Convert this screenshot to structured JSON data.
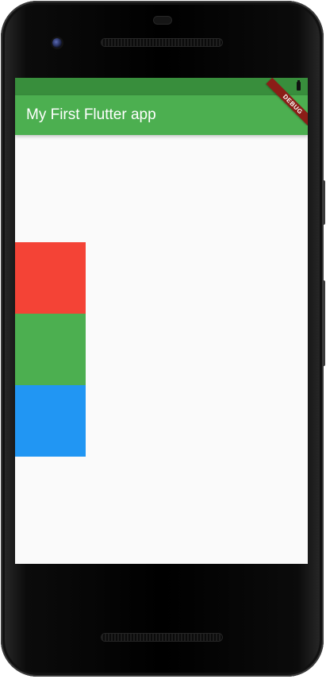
{
  "app": {
    "title": "My First Flutter app",
    "debug_banner": "DEBUG"
  },
  "theme": {
    "status_bar_color": "#388e3c",
    "app_bar_color": "#4caf50",
    "background_color": "#fafafa"
  },
  "column_boxes": [
    {
      "name": "red-box",
      "color": "#f44336"
    },
    {
      "name": "green-box",
      "color": "#4caf50"
    },
    {
      "name": "blue-box",
      "color": "#2196f3"
    }
  ]
}
